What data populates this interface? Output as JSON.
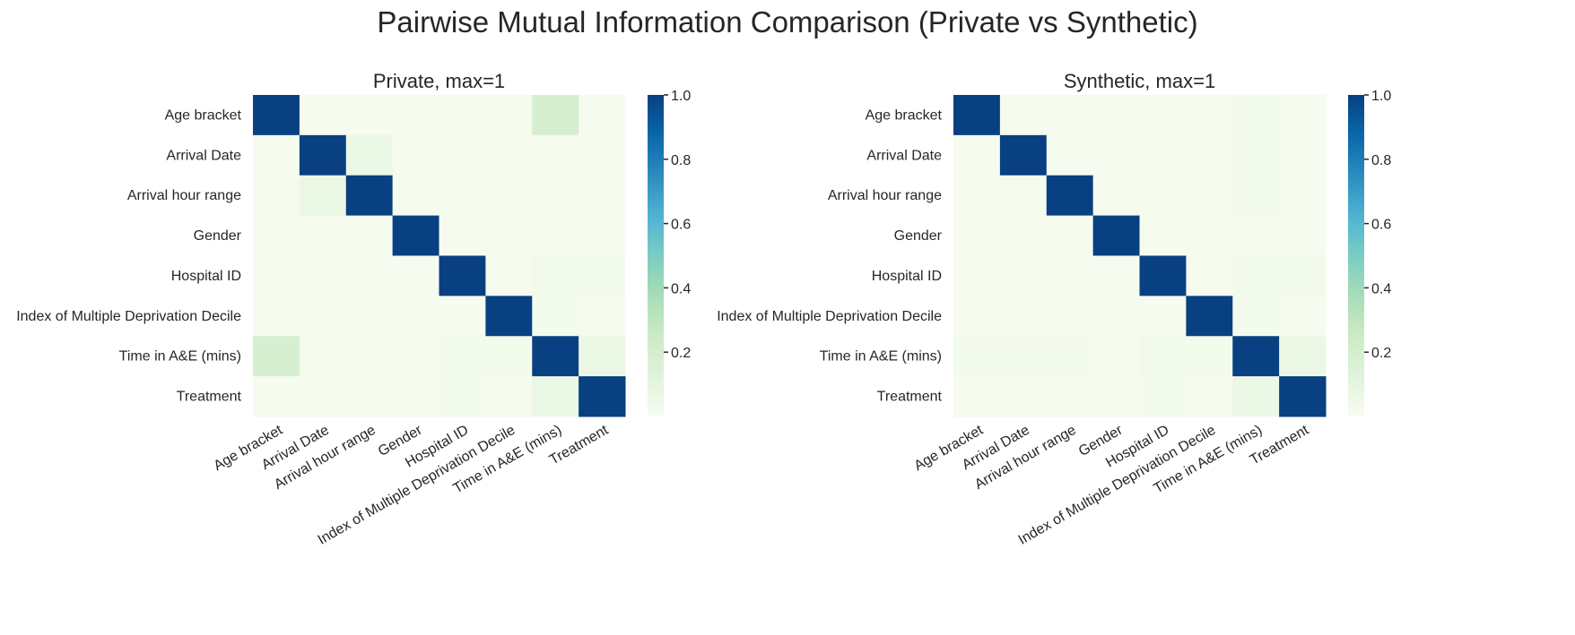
{
  "title": "Pairwise Mutual Information Comparison (Private vs Synthetic)",
  "chart_data": [
    {
      "type": "heatmap",
      "title": "Private, max=1",
      "labels": [
        "Age bracket",
        "Arrival Date",
        "Arrival hour range",
        "Gender",
        "Hospital ID",
        "Index of Multiple Deprivation Decile",
        "Time in A&E (mins)",
        "Treatment"
      ],
      "matrix": [
        [
          1.0,
          0.01,
          0.01,
          0.01,
          0.01,
          0.01,
          0.18,
          0.01
        ],
        [
          0.01,
          1.0,
          0.06,
          0.01,
          0.01,
          0.01,
          0.01,
          0.01
        ],
        [
          0.01,
          0.06,
          1.0,
          0.01,
          0.01,
          0.01,
          0.01,
          0.01
        ],
        [
          0.01,
          0.01,
          0.01,
          1.0,
          0.01,
          0.01,
          0.01,
          0.01
        ],
        [
          0.01,
          0.01,
          0.01,
          0.01,
          1.0,
          0.01,
          0.03,
          0.02
        ],
        [
          0.01,
          0.01,
          0.01,
          0.01,
          0.01,
          1.0,
          0.02,
          0.01
        ],
        [
          0.18,
          0.01,
          0.01,
          0.01,
          0.03,
          0.02,
          1.0,
          0.06
        ],
        [
          0.01,
          0.01,
          0.01,
          0.01,
          0.02,
          0.01,
          0.06,
          1.0
        ]
      ],
      "colormap": "GnBu",
      "vmin": 0,
      "vmax": 1,
      "colorbar_ticks": [
        "0.2",
        "0.4",
        "0.6",
        "0.8",
        "1.0"
      ]
    },
    {
      "type": "heatmap",
      "title": "Synthetic, max=1",
      "labels": [
        "Age bracket",
        "Arrival Date",
        "Arrival hour range",
        "Gender",
        "Hospital ID",
        "Index of Multiple Deprivation Decile",
        "Time in A&E (mins)",
        "Treatment"
      ],
      "matrix": [
        [
          1.0,
          0.01,
          0.01,
          0.01,
          0.01,
          0.01,
          0.02,
          0.01
        ],
        [
          0.01,
          1.0,
          0.01,
          0.01,
          0.01,
          0.01,
          0.02,
          0.01
        ],
        [
          0.01,
          0.01,
          1.0,
          0.01,
          0.01,
          0.01,
          0.02,
          0.01
        ],
        [
          0.01,
          0.01,
          0.01,
          1.0,
          0.01,
          0.01,
          0.01,
          0.01
        ],
        [
          0.01,
          0.01,
          0.01,
          0.01,
          1.0,
          0.01,
          0.03,
          0.02
        ],
        [
          0.01,
          0.01,
          0.01,
          0.01,
          0.01,
          1.0,
          0.02,
          0.01
        ],
        [
          0.02,
          0.02,
          0.02,
          0.01,
          0.03,
          0.02,
          1.0,
          0.06
        ],
        [
          0.01,
          0.01,
          0.01,
          0.01,
          0.02,
          0.01,
          0.06,
          1.0
        ]
      ],
      "colormap": "GnBu",
      "vmin": 0,
      "vmax": 1,
      "colorbar_ticks": [
        "0.2",
        "0.4",
        "0.6",
        "0.8",
        "1.0"
      ]
    }
  ]
}
